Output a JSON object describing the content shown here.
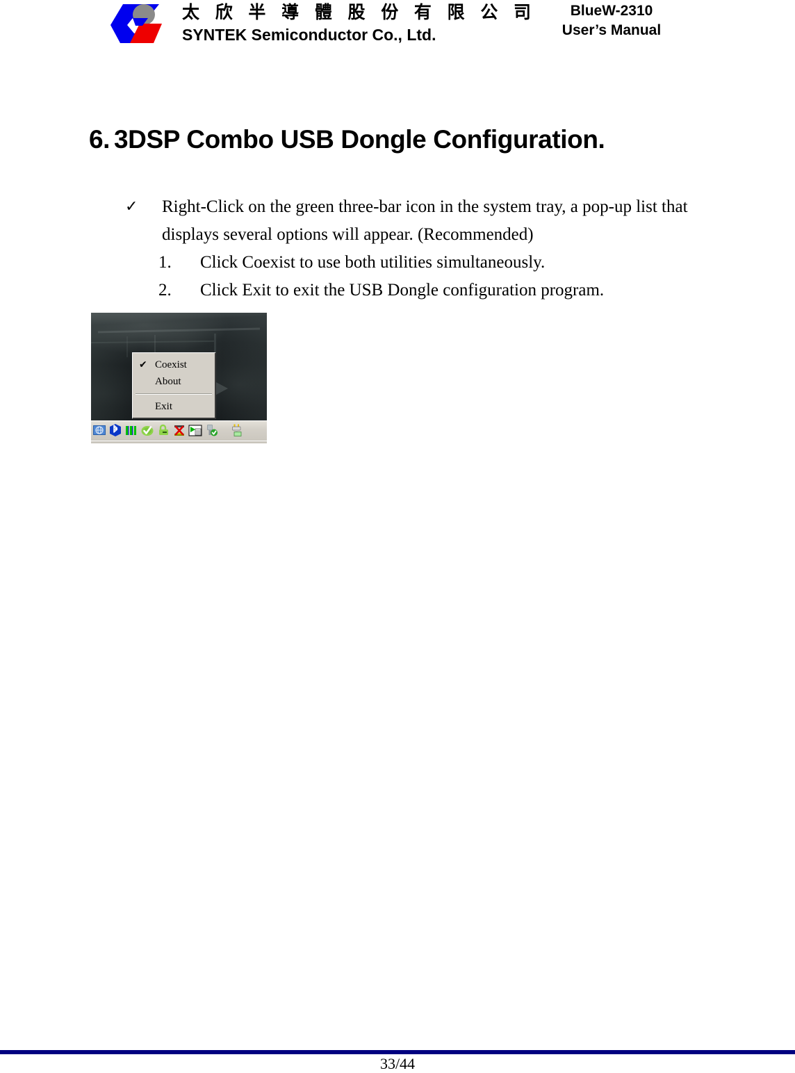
{
  "header": {
    "logo_alt": "SYNTEK logo",
    "company_cn": "太 欣 半 導 體 股 份 有 限 公 司",
    "company_en": "SYNTEK Semiconductor Co., Ltd.",
    "product": "BlueW-2310",
    "doc_type": "User’s Manual"
  },
  "section": {
    "number": "6.",
    "title": "3DSP Combo USB Dongle Configuration."
  },
  "body": {
    "bullet_glyph": "✓",
    "bullet_text": "Right-Click on the green three-bar icon in the system tray, a pop-up list that displays several options will appear. (Recommended)",
    "steps": [
      {
        "num": "1.",
        "text": "Click Coexist to use both utilities simultaneously."
      },
      {
        "num": "2.",
        "text": "Click Exit to exit the USB Dongle configuration program."
      }
    ]
  },
  "figure": {
    "menu": {
      "items": [
        {
          "label": "Coexist",
          "checked": true,
          "check_glyph": "✔"
        },
        {
          "label": "About",
          "checked": false,
          "check_glyph": ""
        },
        {
          "label": "Exit",
          "checked": false,
          "check_glyph": ""
        }
      ]
    },
    "tray_icons": [
      "network-monitor-icon",
      "bluetooth-icon",
      "three-bar-signal-icon",
      "green-shield-check-icon",
      "green-lock-icon",
      "red-x-disconnect-icon",
      "media-folder-icon",
      "usb-device-check-icon",
      "power-plug-icon"
    ]
  },
  "footer": {
    "rule_color": "#000080",
    "page_number": "33/44"
  }
}
